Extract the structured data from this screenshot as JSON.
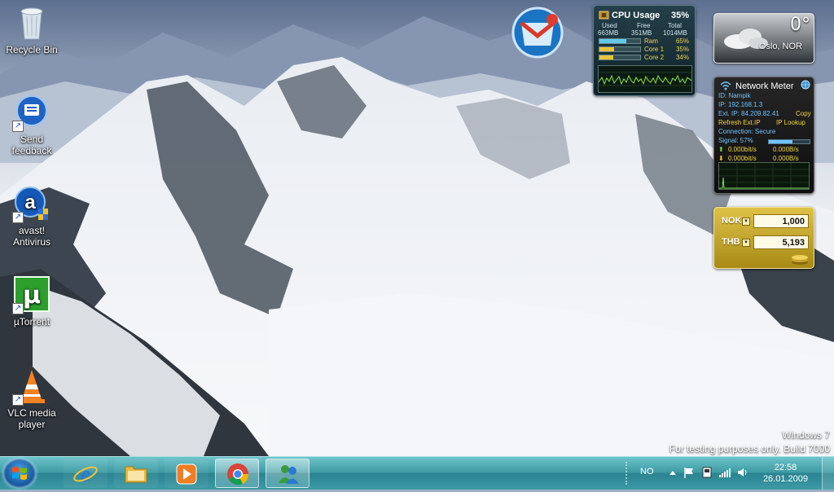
{
  "desktop": {
    "icons": [
      {
        "label": "Recycle Bin"
      },
      {
        "label": "Send feedback"
      },
      {
        "label": "avast! Antivirus"
      },
      {
        "label": "µTorrent"
      },
      {
        "label": "VLC media player"
      }
    ],
    "watermark": {
      "line1": "Windows 7",
      "line2": "For testing purposes only. Build 7000"
    }
  },
  "gadgets": {
    "cpu": {
      "title": "CPU Usage",
      "percent": "35%",
      "headers": [
        "Used",
        "Free",
        "Total"
      ],
      "values": [
        "663MB",
        "351MB",
        "1014MB"
      ],
      "bars": [
        {
          "label": "Ram",
          "value": "65%",
          "fraction": 0.65
        },
        {
          "label": "Core 1",
          "value": "35%",
          "fraction": 0.35
        },
        {
          "label": "Core 2",
          "value": "34%",
          "fraction": 0.34
        }
      ]
    },
    "weather": {
      "temperature": "0°",
      "city": "Oslo, NOR"
    },
    "network": {
      "title": "Network Meter",
      "id": "ID: Nampik",
      "ip": "IP: 192.168.1.3",
      "ext_ip": "Ext. IP: 84.209.82.41",
      "copy": "Copy",
      "refresh": "Refresh Ext.IP",
      "lookup": "IP Lookup",
      "connection": "Connection: Secure",
      "signal": "Signal: 57%",
      "signal_fraction": 0.57,
      "up_bits": "0.000bit/s",
      "up_bytes": "0.000B/s",
      "down_bits": "0.000bit/s",
      "down_bytes": "0.000B/s"
    },
    "currency": {
      "from_code": "NOK",
      "from_amount": "1,000",
      "to_code": "THB",
      "to_amount": "5,193"
    }
  },
  "taskbar": {
    "language": "NO",
    "time": "22:58",
    "date": "26.01.2009"
  }
}
